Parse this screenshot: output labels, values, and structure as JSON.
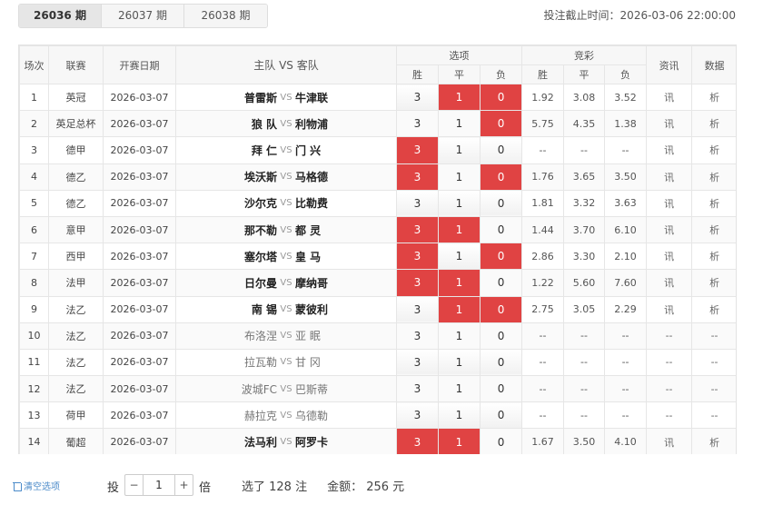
{
  "tabs": [
    {
      "label": "26036 期",
      "active": true
    },
    {
      "label": "26037 期",
      "active": false
    },
    {
      "label": "26038 期",
      "active": false
    }
  ],
  "deadline": "投注截止时间：2026-03-06 22:00:00",
  "headers": {
    "no": "场次",
    "league": "联赛",
    "date": "开赛日期",
    "teams": "主队 VS 客队",
    "options": "选项",
    "jingcai": "竞彩",
    "win": "胜",
    "draw": "平",
    "lose": "负",
    "info": "资讯",
    "data": "数据"
  },
  "rows": [
    {
      "no": "1",
      "league": "英冠",
      "date": "2026-03-07",
      "home": "普雷斯",
      "vs": "VS",
      "away": "牛津联",
      "opts": [
        "3",
        "1",
        "0"
      ],
      "sel": [
        false,
        true,
        true
      ],
      "odds": [
        "1.92",
        "3.08",
        "3.52"
      ],
      "info": "讯",
      "data": "析",
      "dim": false
    },
    {
      "no": "2",
      "league": "英足总杯",
      "date": "2026-03-07",
      "home": "狼 队",
      "vs": "VS",
      "away": "利物浦",
      "opts": [
        "3",
        "1",
        "0"
      ],
      "sel": [
        false,
        false,
        true
      ],
      "odds": [
        "5.75",
        "4.35",
        "1.38"
      ],
      "info": "讯",
      "data": "析",
      "dim": false
    },
    {
      "no": "3",
      "league": "德甲",
      "date": "2026-03-07",
      "home": "拜 仁",
      "vs": "VS",
      "away": "门 兴",
      "opts": [
        "3",
        "1",
        "0"
      ],
      "sel": [
        true,
        false,
        false
      ],
      "odds": [
        "--",
        "--",
        "--"
      ],
      "info": "讯",
      "data": "析",
      "dim": false
    },
    {
      "no": "4",
      "league": "德乙",
      "date": "2026-03-07",
      "home": "埃沃斯",
      "vs": "VS",
      "away": "马格德",
      "opts": [
        "3",
        "1",
        "0"
      ],
      "sel": [
        true,
        false,
        true
      ],
      "odds": [
        "1.76",
        "3.65",
        "3.50"
      ],
      "info": "讯",
      "data": "析",
      "dim": false
    },
    {
      "no": "5",
      "league": "德乙",
      "date": "2026-03-07",
      "home": "沙尔克",
      "vs": "VS",
      "away": "比勒费",
      "opts": [
        "3",
        "1",
        "0"
      ],
      "sel": [
        false,
        false,
        false
      ],
      "odds": [
        "1.81",
        "3.32",
        "3.63"
      ],
      "info": "讯",
      "data": "析",
      "dim": false
    },
    {
      "no": "6",
      "league": "意甲",
      "date": "2026-03-07",
      "home": "那不勒",
      "vs": "VS",
      "away": "都 灵",
      "opts": [
        "3",
        "1",
        "0"
      ],
      "sel": [
        true,
        true,
        false
      ],
      "odds": [
        "1.44",
        "3.70",
        "6.10"
      ],
      "info": "讯",
      "data": "析",
      "dim": false
    },
    {
      "no": "7",
      "league": "西甲",
      "date": "2026-03-07",
      "home": "塞尔塔",
      "vs": "VS",
      "away": "皇 马",
      "opts": [
        "3",
        "1",
        "0"
      ],
      "sel": [
        true,
        false,
        true
      ],
      "odds": [
        "2.86",
        "3.30",
        "2.10"
      ],
      "info": "讯",
      "data": "析",
      "dim": false
    },
    {
      "no": "8",
      "league": "法甲",
      "date": "2026-03-07",
      "home": "日尔曼",
      "vs": "VS",
      "away": "摩纳哥",
      "opts": [
        "3",
        "1",
        "0"
      ],
      "sel": [
        true,
        true,
        false
      ],
      "odds": [
        "1.22",
        "5.60",
        "7.60"
      ],
      "info": "讯",
      "data": "析",
      "dim": false
    },
    {
      "no": "9",
      "league": "法乙",
      "date": "2026-03-07",
      "home": "南 锡",
      "vs": "VS",
      "away": "蒙彼利",
      "opts": [
        "3",
        "1",
        "0"
      ],
      "sel": [
        false,
        true,
        true
      ],
      "odds": [
        "2.75",
        "3.05",
        "2.29"
      ],
      "info": "讯",
      "data": "析",
      "dim": false
    },
    {
      "no": "10",
      "league": "法乙",
      "date": "2026-03-07",
      "home": "布洛涅",
      "vs": "VS",
      "away": "亚 眠",
      "opts": [
        "3",
        "1",
        "0"
      ],
      "sel": [
        false,
        false,
        false
      ],
      "odds": [
        "--",
        "--",
        "--"
      ],
      "info": "--",
      "data": "--",
      "dim": true
    },
    {
      "no": "11",
      "league": "法乙",
      "date": "2026-03-07",
      "home": "拉瓦勒",
      "vs": "VS",
      "away": "甘 冈",
      "opts": [
        "3",
        "1",
        "0"
      ],
      "sel": [
        false,
        false,
        false
      ],
      "odds": [
        "--",
        "--",
        "--"
      ],
      "info": "--",
      "data": "--",
      "dim": true
    },
    {
      "no": "12",
      "league": "法乙",
      "date": "2026-03-07",
      "home": "波城FC",
      "vs": "VS",
      "away": "巴斯蒂",
      "opts": [
        "3",
        "1",
        "0"
      ],
      "sel": [
        false,
        false,
        false
      ],
      "odds": [
        "--",
        "--",
        "--"
      ],
      "info": "--",
      "data": "--",
      "dim": true
    },
    {
      "no": "13",
      "league": "荷甲",
      "date": "2026-03-07",
      "home": "赫拉克",
      "vs": "VS",
      "away": "乌德勒",
      "opts": [
        "3",
        "1",
        "0"
      ],
      "sel": [
        false,
        false,
        false
      ],
      "odds": [
        "--",
        "--",
        "--"
      ],
      "info": "--",
      "data": "--",
      "dim": true
    },
    {
      "no": "14",
      "league": "葡超",
      "date": "2026-03-07",
      "home": "法马利",
      "vs": "VS",
      "away": "阿罗卡",
      "opts": [
        "3",
        "1",
        "0"
      ],
      "sel": [
        true,
        true,
        false
      ],
      "odds": [
        "1.67",
        "3.50",
        "4.10"
      ],
      "info": "讯",
      "data": "析",
      "dim": false
    }
  ],
  "footer": {
    "clear_label": "清空选项",
    "mult_label": "投",
    "minus": "−",
    "plus": "+",
    "multiple": "1",
    "mult_unit": "倍",
    "selected": "选了 128 注",
    "amount": "金额： 256 元"
  },
  "colors": {
    "selected": "#e04343",
    "link": "#4a8ac9"
  }
}
